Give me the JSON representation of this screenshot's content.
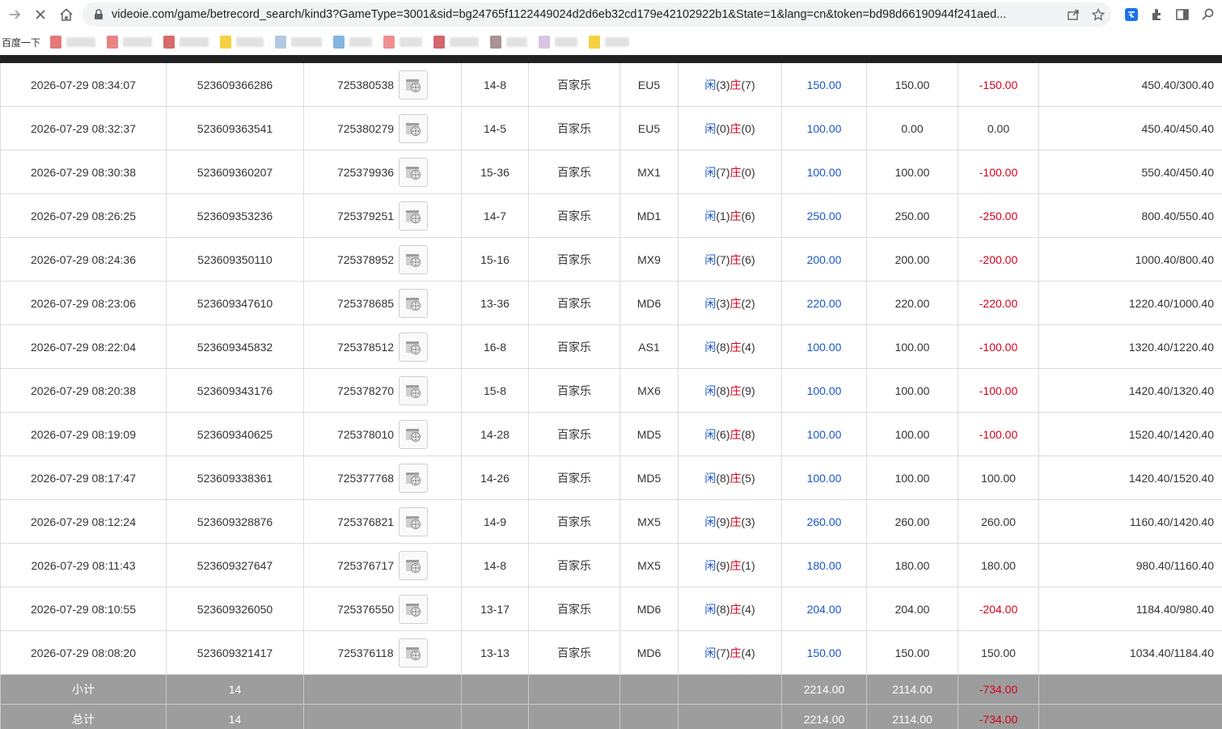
{
  "browser": {
    "url": "videoie.com/game/betrecord_search/kind3?GameType=3001&sid=bg24765f1122449024d2d6eb32cd179e42102922b1&State=1&lang=cn&token=bd98d66190944f241aed...",
    "bookmark_first": "百度一下",
    "bookmark_colors": [
      "#d94b4b",
      "#e15a5a",
      "#c93a3a",
      "#f2c200",
      "#9ab7d4",
      "#5b9bd5",
      "#e86b6b",
      "#c4313b",
      "#8a6f6f",
      "#c9b3d9",
      "#f2c200"
    ]
  },
  "table": {
    "rows": [
      {
        "time": "2026-07-29 08:34:07",
        "bet_no": "523609366286",
        "round_no": "725380538",
        "shoe": "14-8",
        "game": "百家乐",
        "table": "EU5",
        "player_label": "闲",
        "player_score": "(3)",
        "banker_label": "庄",
        "banker_score": "(7)",
        "bet": "150.00",
        "valid": "150.00",
        "win": "-150.00",
        "win_color": "red",
        "balance": "450.40/300.40"
      },
      {
        "time": "2026-07-29 08:32:37",
        "bet_no": "523609363541",
        "round_no": "725380279",
        "shoe": "14-5",
        "game": "百家乐",
        "table": "EU5",
        "player_label": "闲",
        "player_score": "(0)",
        "banker_label": "庄",
        "banker_score": "(0)",
        "bet": "100.00",
        "valid": "0.00",
        "win": "0.00",
        "win_color": "normal",
        "balance": "450.40/450.40"
      },
      {
        "time": "2026-07-29 08:30:38",
        "bet_no": "523609360207",
        "round_no": "725379936",
        "shoe": "15-36",
        "game": "百家乐",
        "table": "MX1",
        "player_label": "闲",
        "player_score": "(7)",
        "banker_label": "庄",
        "banker_score": "(0)",
        "bet": "100.00",
        "valid": "100.00",
        "win": "-100.00",
        "win_color": "red",
        "balance": "550.40/450.40"
      },
      {
        "time": "2026-07-29 08:26:25",
        "bet_no": "523609353236",
        "round_no": "725379251",
        "shoe": "14-7",
        "game": "百家乐",
        "table": "MD1",
        "player_label": "闲",
        "player_score": "(1)",
        "banker_label": "庄",
        "banker_score": "(6)",
        "bet": "250.00",
        "valid": "250.00",
        "win": "-250.00",
        "win_color": "red",
        "balance": "800.40/550.40"
      },
      {
        "time": "2026-07-29 08:24:36",
        "bet_no": "523609350110",
        "round_no": "725378952",
        "shoe": "15-16",
        "game": "百家乐",
        "table": "MX9",
        "player_label": "闲",
        "player_score": "(7)",
        "banker_label": "庄",
        "banker_score": "(6)",
        "bet": "200.00",
        "valid": "200.00",
        "win": "-200.00",
        "win_color": "red",
        "balance": "1000.40/800.40"
      },
      {
        "time": "2026-07-29 08:23:06",
        "bet_no": "523609347610",
        "round_no": "725378685",
        "shoe": "13-36",
        "game": "百家乐",
        "table": "MD6",
        "player_label": "闲",
        "player_score": "(3)",
        "banker_label": "庄",
        "banker_score": "(2)",
        "bet": "220.00",
        "valid": "220.00",
        "win": "-220.00",
        "win_color": "red",
        "balance": "1220.40/1000.40"
      },
      {
        "time": "2026-07-29 08:22:04",
        "bet_no": "523609345832",
        "round_no": "725378512",
        "shoe": "16-8",
        "game": "百家乐",
        "table": "AS1",
        "player_label": "闲",
        "player_score": "(8)",
        "banker_label": "庄",
        "banker_score": "(4)",
        "bet": "100.00",
        "valid": "100.00",
        "win": "-100.00",
        "win_color": "red",
        "balance": "1320.40/1220.40"
      },
      {
        "time": "2026-07-29 08:20:38",
        "bet_no": "523609343176",
        "round_no": "725378270",
        "shoe": "15-8",
        "game": "百家乐",
        "table": "MX6",
        "player_label": "闲",
        "player_score": "(8)",
        "banker_label": "庄",
        "banker_score": "(9)",
        "bet": "100.00",
        "valid": "100.00",
        "win": "-100.00",
        "win_color": "red",
        "balance": "1420.40/1320.40"
      },
      {
        "time": "2026-07-29 08:19:09",
        "bet_no": "523609340625",
        "round_no": "725378010",
        "shoe": "14-28",
        "game": "百家乐",
        "table": "MD5",
        "player_label": "闲",
        "player_score": "(6)",
        "banker_label": "庄",
        "banker_score": "(8)",
        "bet": "100.00",
        "valid": "100.00",
        "win": "-100.00",
        "win_color": "red",
        "balance": "1520.40/1420.40"
      },
      {
        "time": "2026-07-29 08:17:47",
        "bet_no": "523609338361",
        "round_no": "725377768",
        "shoe": "14-26",
        "game": "百家乐",
        "table": "MD5",
        "player_label": "闲",
        "player_score": "(8)",
        "banker_label": "庄",
        "banker_score": "(5)",
        "bet": "100.00",
        "valid": "100.00",
        "win": "100.00",
        "win_color": "normal",
        "balance": "1420.40/1520.40"
      },
      {
        "time": "2026-07-29 08:12:24",
        "bet_no": "523609328876",
        "round_no": "725376821",
        "shoe": "14-9",
        "game": "百家乐",
        "table": "MX5",
        "player_label": "闲",
        "player_score": "(9)",
        "banker_label": "庄",
        "banker_score": "(3)",
        "bet": "260.00",
        "valid": "260.00",
        "win": "260.00",
        "win_color": "normal",
        "balance": "1160.40/1420.40"
      },
      {
        "time": "2026-07-29 08:11:43",
        "bet_no": "523609327647",
        "round_no": "725376717",
        "shoe": "14-8",
        "game": "百家乐",
        "table": "MX5",
        "player_label": "闲",
        "player_score": "(9)",
        "banker_label": "庄",
        "banker_score": "(1)",
        "bet": "180.00",
        "valid": "180.00",
        "win": "180.00",
        "win_color": "normal",
        "balance": "980.40/1160.40"
      },
      {
        "time": "2026-07-29 08:10:55",
        "bet_no": "523609326050",
        "round_no": "725376550",
        "shoe": "13-17",
        "game": "百家乐",
        "table": "MD6",
        "player_label": "闲",
        "player_score": "(8)",
        "banker_label": "庄",
        "banker_score": "(4)",
        "bet": "204.00",
        "valid": "204.00",
        "win": "-204.00",
        "win_color": "red",
        "balance": "1184.40/980.40"
      },
      {
        "time": "2026-07-29 08:08:20",
        "bet_no": "523609321417",
        "round_no": "725376118",
        "shoe": "13-13",
        "game": "百家乐",
        "table": "MD6",
        "player_label": "闲",
        "player_score": "(7)",
        "banker_label": "庄",
        "banker_score": "(4)",
        "bet": "150.00",
        "valid": "150.00",
        "win": "150.00",
        "win_color": "normal",
        "balance": "1034.40/1184.40"
      }
    ],
    "subtotal": {
      "label": "小计",
      "count": "14",
      "bet": "2214.00",
      "valid": "2114.00",
      "win": "-734.00"
    },
    "total": {
      "label": "总计",
      "count": "14",
      "bet": "2214.00",
      "valid": "2114.00",
      "win": "-734.00"
    }
  }
}
